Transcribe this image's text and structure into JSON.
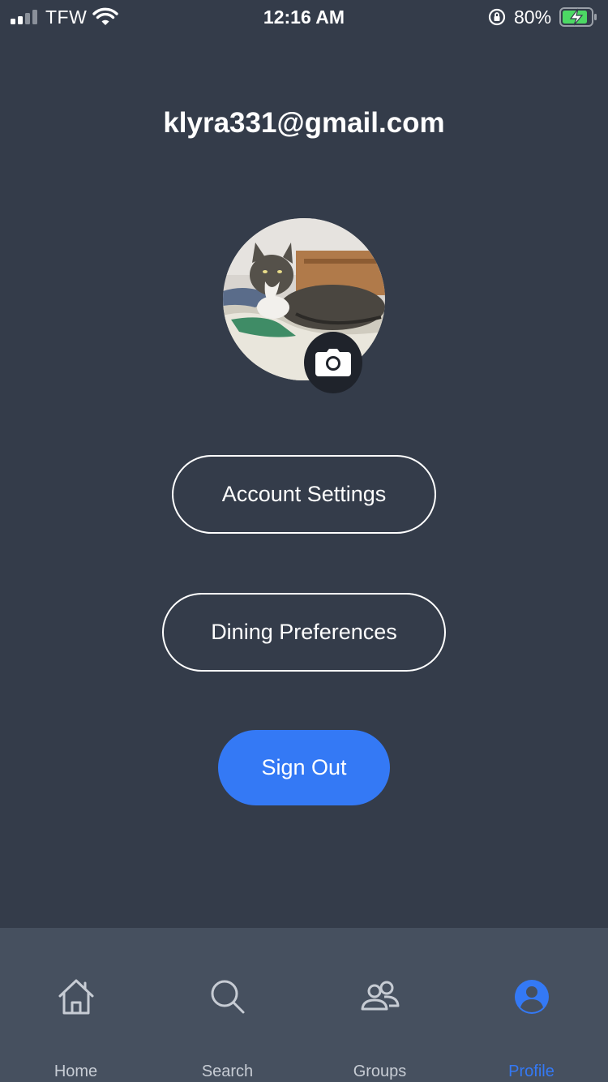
{
  "status_bar": {
    "carrier": "TFW",
    "time": "12:16 AM",
    "battery_percent": "80%",
    "signal_bars": 2,
    "charging": true
  },
  "profile": {
    "email": "klyra331@gmail.com",
    "avatar_alt": "profile photo"
  },
  "buttons": {
    "account_settings": "Account Settings",
    "dining_preferences": "Dining Preferences",
    "sign_out": "Sign Out"
  },
  "tabs": [
    {
      "label": "Home",
      "icon": "home-icon",
      "active": false
    },
    {
      "label": "Search",
      "icon": "search-icon",
      "active": false
    },
    {
      "label": "Groups",
      "icon": "groups-icon",
      "active": false
    },
    {
      "label": "Profile",
      "icon": "profile-icon",
      "active": true
    }
  ],
  "colors": {
    "background": "#343c4a",
    "tab_bar": "#46505f",
    "accent": "#3479f5",
    "inactive": "#c7ccd4"
  }
}
